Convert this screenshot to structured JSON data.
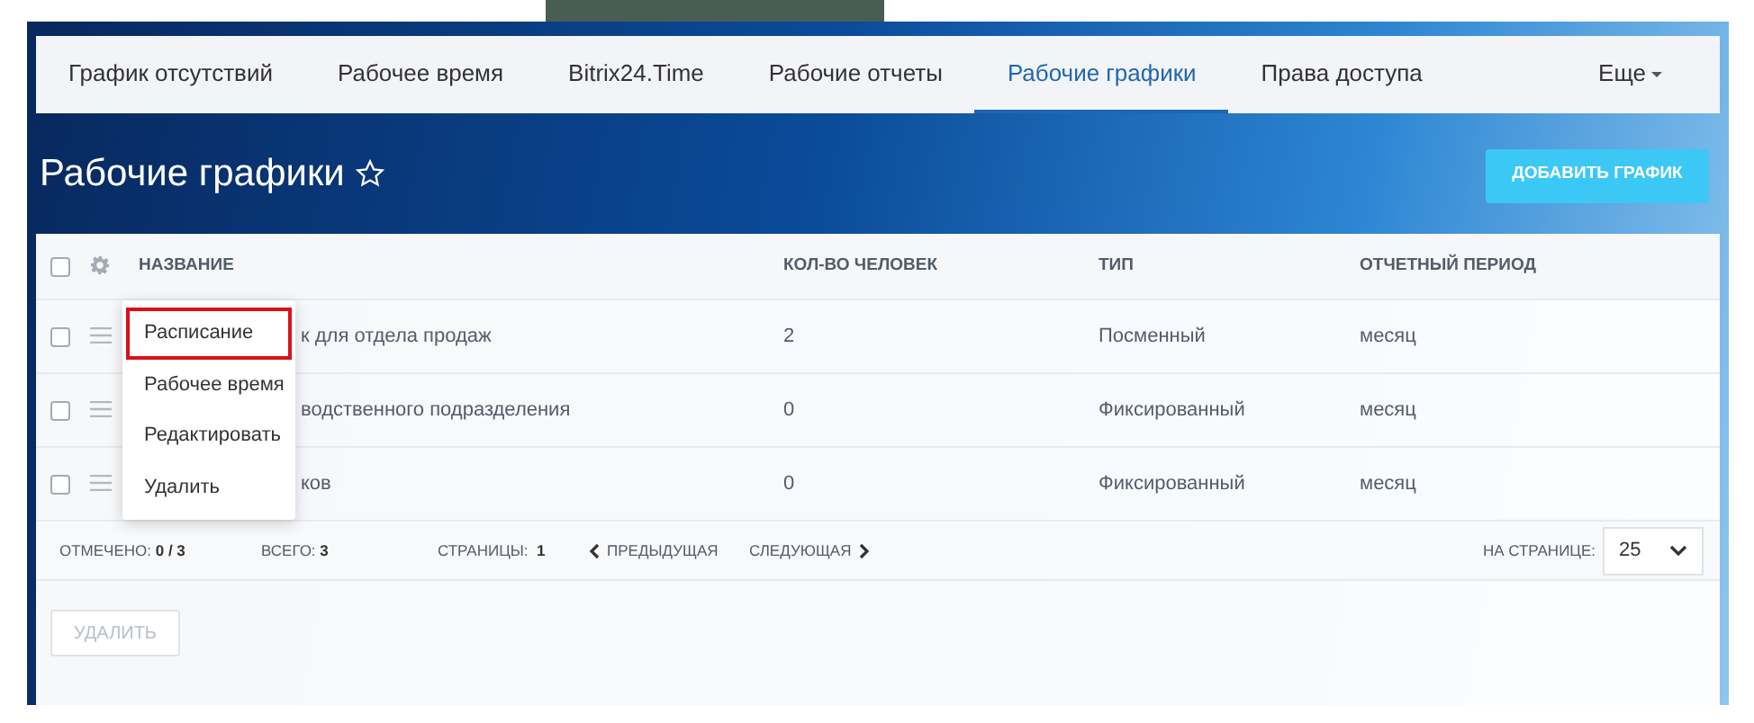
{
  "tabs": [
    {
      "label": "График отсутствий",
      "selected": false
    },
    {
      "label": "Рабочее время",
      "selected": false
    },
    {
      "label": "Bitrix24.Time",
      "selected": false
    },
    {
      "label": "Рабочие отчеты",
      "selected": false
    },
    {
      "label": "Рабочие графики",
      "selected": true
    },
    {
      "label": "Права доступа",
      "selected": false
    }
  ],
  "more_menu": {
    "label": "Еще"
  },
  "page_title": "Рабочие графики",
  "add_button": "ДОБАВИТЬ ГРАФИК",
  "table": {
    "columns": [
      "НАЗВАНИЕ",
      "КОЛ-ВО ЧЕЛОВЕК",
      "ТИП",
      "ОТЧЕТНЫЙ ПЕРИОД"
    ],
    "select_all_checked": false,
    "rows": [
      {
        "checked": false,
        "name": "к для отдела продаж",
        "count": "2",
        "type": "Посменный",
        "period": "месяц"
      },
      {
        "checked": false,
        "name": "водственного подразделения",
        "count": "0",
        "type": "Фиксированный",
        "period": "месяц"
      },
      {
        "checked": false,
        "name": "ков",
        "count": "0",
        "type": "Фиксированный",
        "period": "месяц"
      }
    ]
  },
  "context_menu": [
    {
      "label": "Расписание",
      "highlighted": true
    },
    {
      "label": "Рабочее время",
      "highlighted": false
    },
    {
      "label": "Редактировать",
      "highlighted": false
    },
    {
      "label": "Удалить",
      "highlighted": false
    }
  ],
  "footer": {
    "marked_label": "ОТМЕЧЕНО:",
    "marked_value": "0 / 3",
    "total_label": "ВСЕГО:",
    "total_value": "3",
    "pages_label": "СТРАНИЦЫ:",
    "page": "1",
    "prev": "ПРЕДЫДУЩАЯ",
    "next": "СЛЕДУЮЩАЯ",
    "per_page_label": "НА СТРАНИЦЕ:",
    "per_page": "25"
  },
  "delete_button": {
    "label": "УДАЛИТЬ",
    "disabled": true
  }
}
